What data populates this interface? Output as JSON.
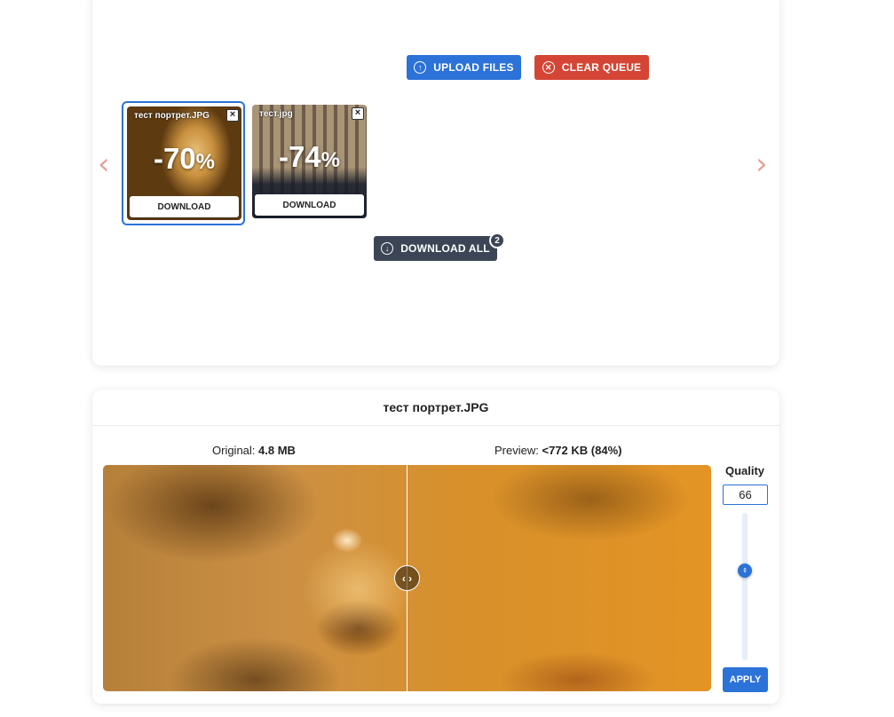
{
  "toolbar": {
    "upload_label": "UPLOAD FILES",
    "clear_label": "CLEAR QUEUE",
    "download_all_label": "DOWNLOAD ALL",
    "download_all_count": "2"
  },
  "nav": {
    "prev_glyph": "‹",
    "next_glyph": "›"
  },
  "queue": [
    {
      "name": "тест портрет.JPG",
      "reduction": "-70",
      "percent_symbol": "%",
      "download_label": "DOWNLOAD",
      "selected": true
    },
    {
      "name": "тест.jpg",
      "reduction": "-74",
      "percent_symbol": "%",
      "download_label": "DOWNLOAD",
      "selected": false
    }
  ],
  "preview": {
    "file_title": "тест портрет.JPG",
    "original_label": "Original:",
    "original_size": "4.8 MB",
    "preview_label": "Preview:",
    "preview_size": "<772 KB",
    "preview_percent": "(84%)"
  },
  "quality": {
    "label": "Quality",
    "value": "66",
    "slider_level": 0.66,
    "apply_label": "APPLY"
  },
  "colors": {
    "primary": "#2b72d9",
    "danger": "#d44535",
    "dark": "#3b4555",
    "arrow": "#e2a39b"
  },
  "icons": {
    "upload": "upload-circle-icon",
    "clear": "close-circle-icon",
    "download_all": "download-circle-icon",
    "compare_handle": "left-right-arrows-icon"
  }
}
